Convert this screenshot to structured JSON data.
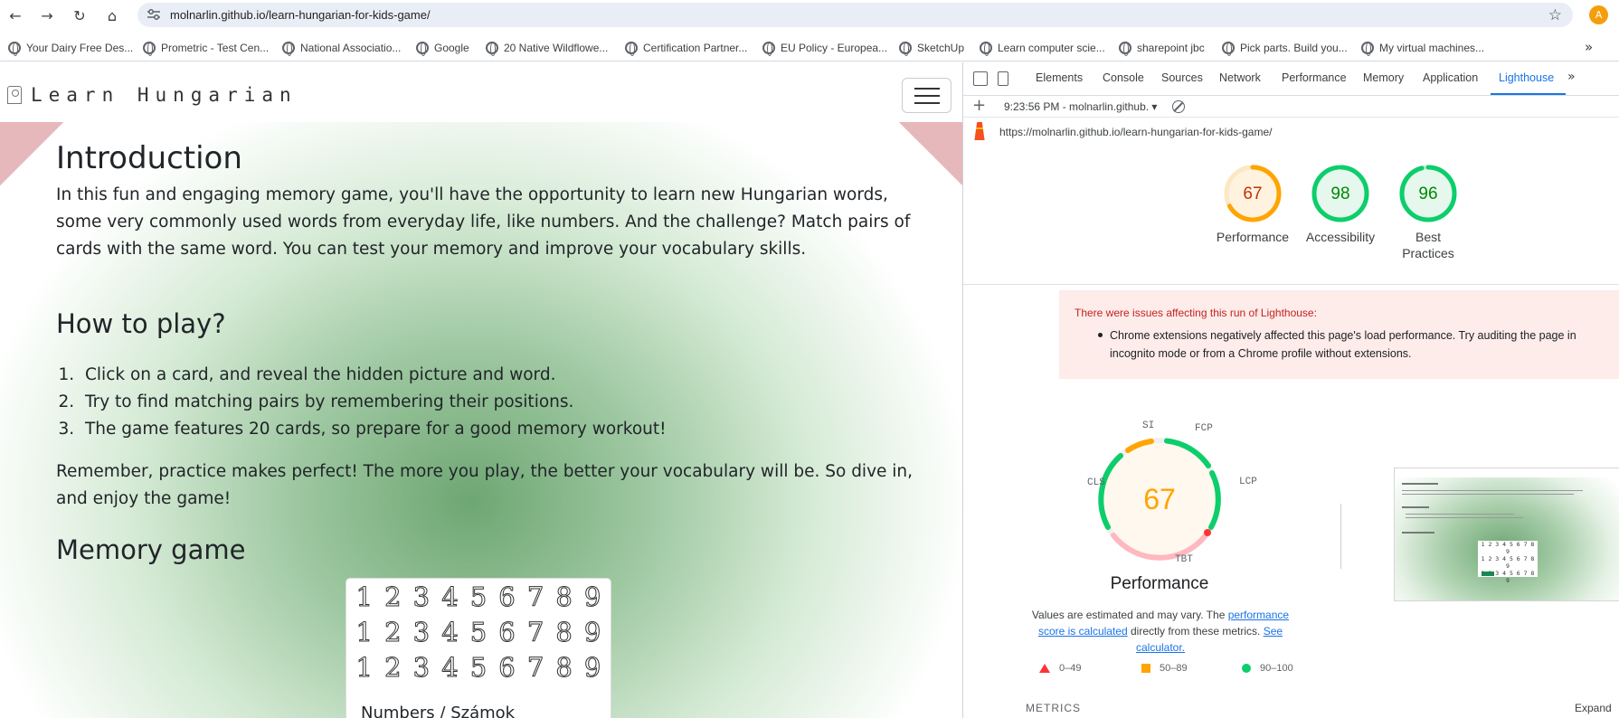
{
  "browser": {
    "url": "molnarlin.github.io/learn-hungarian-for-kids-game/",
    "profile_initial": "A",
    "bookmarks": [
      "Your Dairy Free Des...",
      "Prometric - Test Cen...",
      "National Associatio...",
      "Google",
      "20 Native Wildflowe...",
      "Certification Partner...",
      "EU Policy - Europea...",
      "SketchUp",
      "Learn computer scie...",
      "sharepoint jbc",
      "Pick parts. Build you...",
      "My virtual machines..."
    ],
    "icons": [
      "back-icon",
      "forward-icon",
      "reload-icon",
      "home-icon",
      "site-settings-icon",
      "bookmark-star-icon",
      "bookmarks-overflow-icon"
    ]
  },
  "site": {
    "brand": "Learn Hungarian",
    "intro_heading": "Introduction",
    "intro_text": "In this fun and engaging memory game, you'll have the opportunity to learn new Hungarian words, some very commonly used words from everyday life, like numbers. And the challenge? Match pairs of cards with the same word. You can test your memory and improve your vocabulary skills.",
    "howto_heading": "How to play?",
    "howto_steps": [
      "Click on a card, and reveal the hidden picture and word.",
      "Try to find matching pairs by remembering their positions.",
      "The game features 20 cards, so prepare for a good memory workout!"
    ],
    "remember_text": "Remember, practice makes perfect! The more you play, the better your vocabulary will be. So dive in, and enjoy the game!",
    "memory_heading": "Memory game",
    "card_digits": [
      "1",
      "2",
      "3",
      "4",
      "5",
      "6",
      "7",
      "8",
      "9"
    ],
    "card_caption": "Numbers / Számok"
  },
  "devtools": {
    "tabs": [
      "Elements",
      "Console",
      "Sources",
      "Network",
      "Performance",
      "Memory",
      "Application",
      "Lighthouse"
    ],
    "active_tab": "Lighthouse",
    "run_selector": "9:23:56 PM - molnarlin.github.",
    "report_url": "https://molnarlin.github.io/learn-hungarian-for-kids-game/",
    "scores": [
      {
        "label": "Performance",
        "value": 67,
        "color": "#ffa400"
      },
      {
        "label": "Accessibility",
        "value": 98,
        "color": "#0cce6b"
      },
      {
        "label": "Best Practices",
        "value": 96,
        "color": "#0cce6b"
      }
    ],
    "warning_title": "There were issues affecting this run of Lighthouse:",
    "warning_item": "Chrome extensions negatively affected this page's load performance. Try auditing the page in incognito mode or from a Chrome profile without extensions.",
    "perf_score": 67,
    "metric_labels": [
      "SI",
      "FCP",
      "LCP",
      "TBT",
      "CLS"
    ],
    "perf_title": "Performance",
    "perf_desc_1": "Values are estimated and may vary. The ",
    "perf_desc_link1": "performance score is calculated",
    "perf_desc_2": " directly from these metrics. ",
    "perf_desc_link2": "See calculator.",
    "legend": [
      {
        "range": "0–49",
        "color": "#ff3333"
      },
      {
        "range": "50–89",
        "color": "#ffa400"
      },
      {
        "range": "90–100",
        "color": "#0cce6b"
      }
    ],
    "metrics_label": "METRICS",
    "expand_label": "Expand"
  }
}
